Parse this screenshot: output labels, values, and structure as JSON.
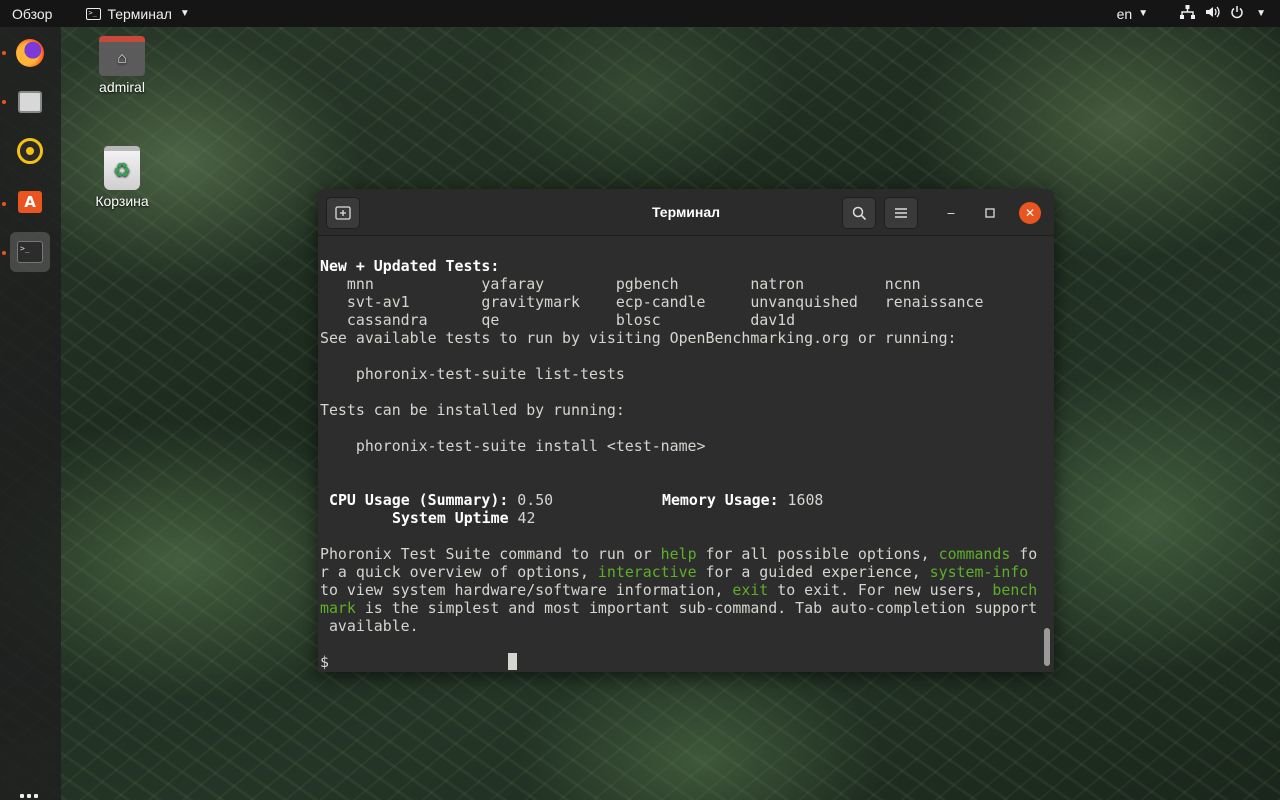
{
  "topbar": {
    "activities": "Обзор",
    "app_name": "Терминал",
    "language": "en"
  },
  "dock": {
    "items": [
      "firefox-icon",
      "files-icon",
      "rhythmbox-icon",
      "software-icon",
      "terminal-icon"
    ]
  },
  "desktop": {
    "home_label": "admiral",
    "trash_label": "Корзина"
  },
  "terminal": {
    "title": "Терминал",
    "prompt": "$",
    "lines": {
      "l1": "New + Updated Tests:",
      "l2": "   mnn            yafaray        pgbench        natron         ncnn",
      "l3": "   svt-av1        gravitymark    ecp-candle     unvanquished   renaissance",
      "l4": "   cassandra      qe             blosc          dav1d",
      "l5": "See available tests to run by visiting OpenBenchmarking.org or running:",
      "l6": "    phoronix-test-suite list-tests",
      "l7": "Tests can be installed by running:",
      "l8": "    phoronix-test-suite install <test-name>"
    },
    "stats": {
      "cpu_label": "CPU Usage (Summary):",
      "cpu_value": "0.50",
      "mem_label": "Memory Usage:",
      "mem_value": "1608",
      "uptime_label": "System Uptime",
      "uptime_value": "42"
    },
    "help": {
      "p1": "Phoronix Test Suite command to run or ",
      "k_help": "help",
      "p2": " for all possible options, ",
      "k_commands1": "commands",
      "k_commands2": " fo",
      "p3": "r a quick overview of options, ",
      "k_interactive": "interactive",
      "p4": " for a guided experience, ",
      "k_sysinfo": "system-info",
      "p5": "to view system hardware/software information, ",
      "k_exit": "exit",
      "p6": " to exit. For new users, ",
      "k_bench": "bench",
      "k_mark": "mark",
      "p7": " is the simplest and most important sub-command. Tab auto-completion support",
      "p8": " available."
    }
  },
  "colors": {
    "accent": "#e95420",
    "keyword_green": "#5fae2a",
    "terminal_bg": "#2d2d2d"
  }
}
